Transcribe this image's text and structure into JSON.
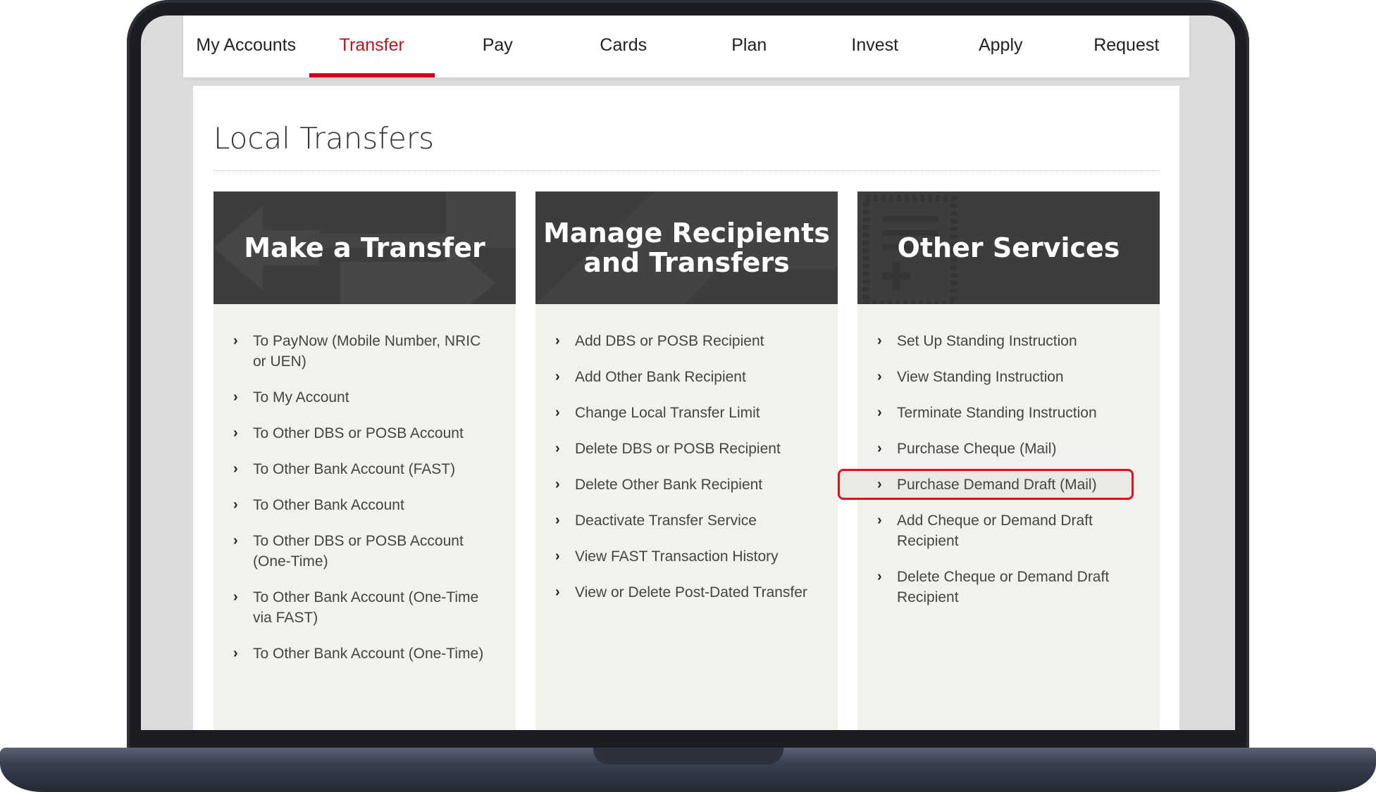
{
  "nav": {
    "items": [
      "My Accounts",
      "Transfer",
      "Pay",
      "Cards",
      "Plan",
      "Invest",
      "Apply",
      "Request"
    ],
    "active": "Transfer"
  },
  "page": {
    "title": "Local Transfers"
  },
  "columns": [
    {
      "title": "Make a Transfer",
      "links": [
        "To PayNow (Mobile Number, NRIC or UEN)",
        "To My Account",
        "To Other DBS or POSB Account",
        "To Other Bank Account (FAST)",
        "To Other Bank Account",
        "To Other DBS or POSB Account (One-Time)",
        "To Other Bank Account (One-Time via FAST)",
        "To Other Bank Account (One-Time)"
      ]
    },
    {
      "title": "Manage Recipients\nand Transfers",
      "links": [
        "Add DBS or POSB Recipient",
        "Add Other Bank Recipient",
        "Change Local Transfer Limit",
        "Delete DBS or POSB Recipient",
        "Delete Other Bank Recipient",
        "Deactivate Transfer Service",
        "View FAST Transaction History",
        "View or Delete Post-Dated Transfer"
      ]
    },
    {
      "title": "Other Services",
      "links": [
        "Set Up Standing Instruction",
        "View Standing Instruction",
        "Terminate Standing Instruction",
        "Purchase Cheque (Mail)",
        "Purchase Demand Draft (Mail)",
        "Add Cheque or Demand Draft Recipient",
        "Delete Cheque or Demand Draft Recipient"
      ],
      "highlighted": "Purchase Demand Draft (Mail)"
    }
  ],
  "colors": {
    "accent": "#d0021b",
    "highlight_border": "#e0101e",
    "header_bg": "#3d3d3d",
    "panel_bg": "#f3f1ec"
  },
  "icons": {
    "chevron": "chevron-right-icon"
  }
}
